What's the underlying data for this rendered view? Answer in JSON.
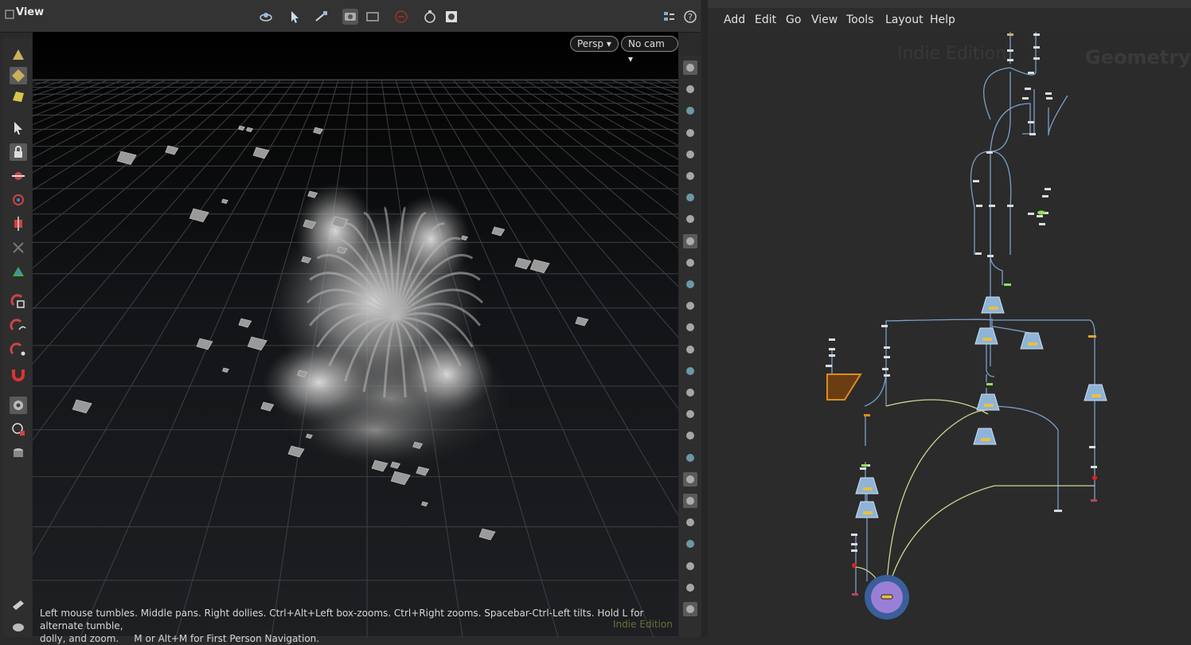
{
  "viewer": {
    "title": "View",
    "persp_label": "Persp",
    "cam_label": "No cam",
    "hint_line1": "Left mouse tumbles. Middle pans. Right dollies. Ctrl+Alt+Left box-zooms. Ctrl+Right zooms. Spacebar-Ctrl-Left tilts. Hold L for alternate tumble,",
    "hint_line2": "dolly, and zoom.     M or Alt+M for First Person Navigation.",
    "watermark": "Indie Edition"
  },
  "network": {
    "menu": [
      "Add",
      "Edit",
      "Go",
      "View",
      "Tools",
      "Layout",
      "Help"
    ],
    "watermark": "Indie Edition",
    "context_label": "Geometry"
  },
  "colors": {
    "accent_orange": "#e08a1e",
    "wire_yellow": "#c8d690",
    "wire_blue": "#7a9fc8",
    "output_purple": "#9a7fd6",
    "flag_green": "#8fe05a",
    "flag_red": "#e02020"
  },
  "icons": {
    "viewer_toolbar": [
      "camera-orbit-icon",
      "select-pointer-icon",
      "handles-icon",
      "camera-tools-icon",
      "snapshot-icon",
      "stop-icon",
      "flipbook-icon",
      "settings-gear-icon",
      "display-options-icon",
      "help-icon"
    ],
    "left_toolbar": [
      "object-select-icon",
      "geometry-select-icon",
      "dynamics-select-icon",
      "arrow-select-icon",
      "lock-icon",
      "move-icon",
      "rotate-icon",
      "scale-icon",
      "bone-icon",
      "transform-handle-icon",
      "snap-grid-icon",
      "snap-curve-icon",
      "snap-point-icon",
      "snap-magnet-icon",
      "camera-view-icon",
      "camera-link-icon",
      "render-region-icon",
      "notes-icon",
      "camera-bottom-icon"
    ],
    "right_toolbar": [
      "wireframe-icon",
      "shaded-icon",
      "lock-camera-icon",
      "headlight-icon",
      "sphere-shade-icon",
      "light-icon",
      "light-bulb-icon",
      "ambient-icon",
      "shading-mode-icon",
      "visibility-icon",
      "backface-icon",
      "point-display-icon",
      "edge-tool-icon",
      "eyedropper-icon",
      "point-numbers-icon",
      "primitive-display-icon",
      "vertex-numbers-icon",
      "curve-display-icon",
      "normals-icon",
      "uv-icon",
      "texture-icon",
      "template-icon",
      "reference-icon",
      "frame-icon",
      "grid-toggle-icon",
      "snapshot-view-icon"
    ]
  }
}
